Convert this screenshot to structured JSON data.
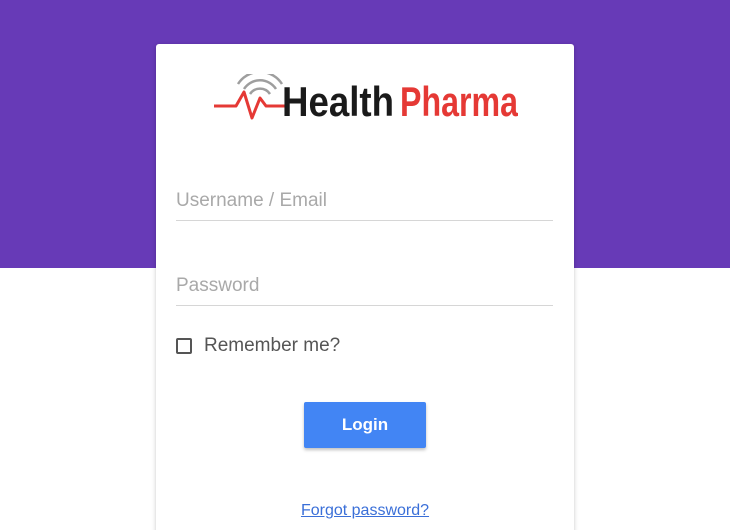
{
  "logo": {
    "word_health": "Health",
    "word_pharma": "Pharma",
    "icon": "heartbeat-wifi-icon",
    "colors": {
      "health": "#1a1a1a",
      "pharma": "#e53935",
      "pulse": "#e53935",
      "signal": "#9e9e9e"
    }
  },
  "form": {
    "username": {
      "placeholder": "Username / Email",
      "value": ""
    },
    "password": {
      "placeholder": "Password",
      "value": ""
    },
    "remember_label": "Remember me?",
    "remember_checked": false,
    "login_label": "Login",
    "forgot_label": "Forgot password?"
  },
  "colors": {
    "banner": "#673ab7",
    "button": "#4285f4",
    "link": "#3a6fd8"
  }
}
